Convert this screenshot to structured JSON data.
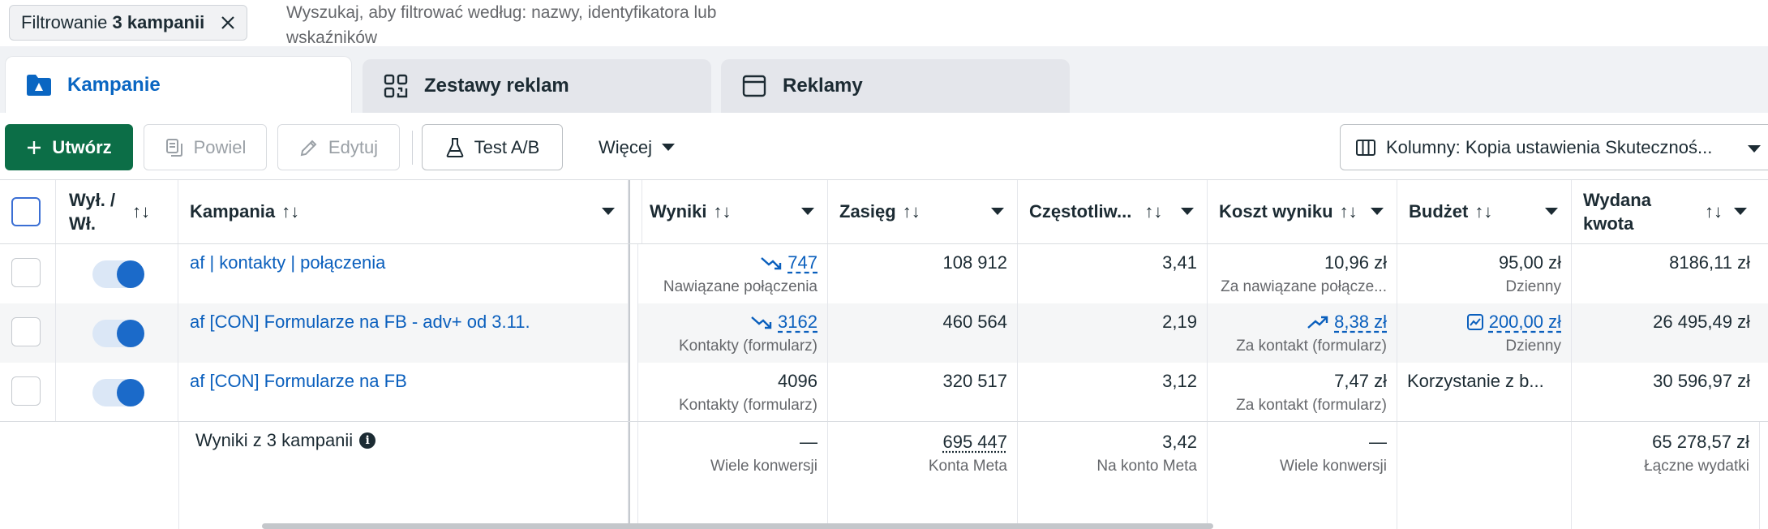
{
  "filter": {
    "chip_prefix": "Filtrowanie",
    "chip_bold": "3 kampanii",
    "search_placeholder": "Wyszukaj, aby filtrować według: nazwy, identyfikatora lub wskaźników"
  },
  "tabs": [
    {
      "label": "Kampanie",
      "icon": "folder-icon",
      "active": true
    },
    {
      "label": "Zestawy reklam",
      "icon": "grid-icon",
      "active": false
    },
    {
      "label": "Reklamy",
      "icon": "ad-window-icon",
      "active": false
    }
  ],
  "toolbar": {
    "create": "Utwórz",
    "duplicate": "Powiel",
    "edit": "Edytuj",
    "ab_test": "Test A/B",
    "more": "Więcej",
    "columns": "Kolumny: Kopia ustawienia Skutecznoś..."
  },
  "columns": {
    "toggle": "Wył. / Wł.",
    "campaign": "Kampania",
    "results": "Wyniki",
    "reach": "Zasięg",
    "frequency": "Częstotliw...",
    "cost": "Koszt wyniku",
    "budget": "Budżet",
    "spent": "Wydana kwota"
  },
  "sort_glyph": "↑↓",
  "rows": [
    {
      "name": "af | kontakty | połączenia",
      "results": "747",
      "results_sub": "Nawiązane połączenia",
      "reach": "108 912",
      "frequency": "3,41",
      "cost": "10,96 zł",
      "cost_sub": "Za nawiązane połącze...",
      "budget": "95,00 zł",
      "budget_sub": "Dzienny",
      "spent": "8186,11 zł"
    },
    {
      "name": "af [CON] Formularze na FB - adv+ od 3.11.",
      "results": "3162",
      "results_sub": "Kontakty (formularz)",
      "reach": "460 564",
      "frequency": "2,19",
      "cost": "8,38 zł",
      "cost_sub": "Za kontakt (formularz)",
      "budget": "200,00 zł",
      "budget_sub": "Dzienny",
      "spent": "26 495,49 zł"
    },
    {
      "name": "af [CON] Formularze na FB",
      "results": "4096",
      "results_sub": "Kontakty (formularz)",
      "reach": "320 517",
      "frequency": "3,12",
      "cost": "7,47 zł",
      "cost_sub": "Za kontakt (formularz)",
      "budget": "Korzystanie z b...",
      "spent": "30 596,97 zł"
    }
  ],
  "footer": {
    "title": "Wyniki z 3 kampanii",
    "results": "—",
    "results_sub": "Wiele konwersji",
    "reach": "695 447",
    "reach_sub": "Konta Meta",
    "frequency": "3,42",
    "frequency_sub": "Na konto Meta",
    "cost": "—",
    "cost_sub": "Wiele konwersji",
    "spent": "65 278,57 zł",
    "spent_sub": "Łączne wydatki"
  },
  "colors": {
    "primary_button": "#0c6e47",
    "link": "#0a5fbd",
    "toggle_on": "#1b6ac9",
    "trend_down": "#0a5fbd"
  }
}
